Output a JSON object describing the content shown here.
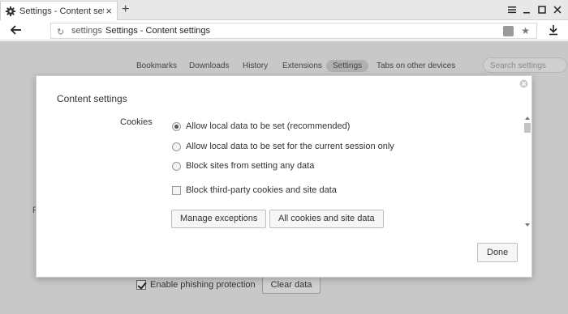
{
  "browser": {
    "tab_title": "Settings - Content settings",
    "url_host": "settings",
    "url_title": "Settings - Content settings"
  },
  "page": {
    "tabs": [
      {
        "label": "Bookmarks",
        "active": false
      },
      {
        "label": "Downloads",
        "active": false
      },
      {
        "label": "History",
        "active": false
      },
      {
        "label": "Extensions",
        "active": false
      },
      {
        "label": "Settings",
        "active": true
      },
      {
        "label": "Tabs on other devices",
        "active": false
      }
    ],
    "search_placeholder": "Search settings",
    "background_fragment": "P",
    "phishing_label": "Enable phishing protection",
    "clear_data_label": "Clear data"
  },
  "dialog": {
    "title": "Content settings",
    "cookies_label": "Cookies",
    "options": [
      {
        "label": "Allow local data to be set (recommended)",
        "type": "radio",
        "checked": true
      },
      {
        "label": "Allow local data to be set for the current session only",
        "type": "radio",
        "checked": false
      },
      {
        "label": "Block sites from setting any data",
        "type": "radio",
        "checked": false
      },
      {
        "label": "Block third-party cookies and site data",
        "type": "checkbox",
        "checked": false
      }
    ],
    "manage_exceptions_label": "Manage exceptions",
    "all_cookies_label": "All cookies and site data",
    "done_label": "Done"
  }
}
